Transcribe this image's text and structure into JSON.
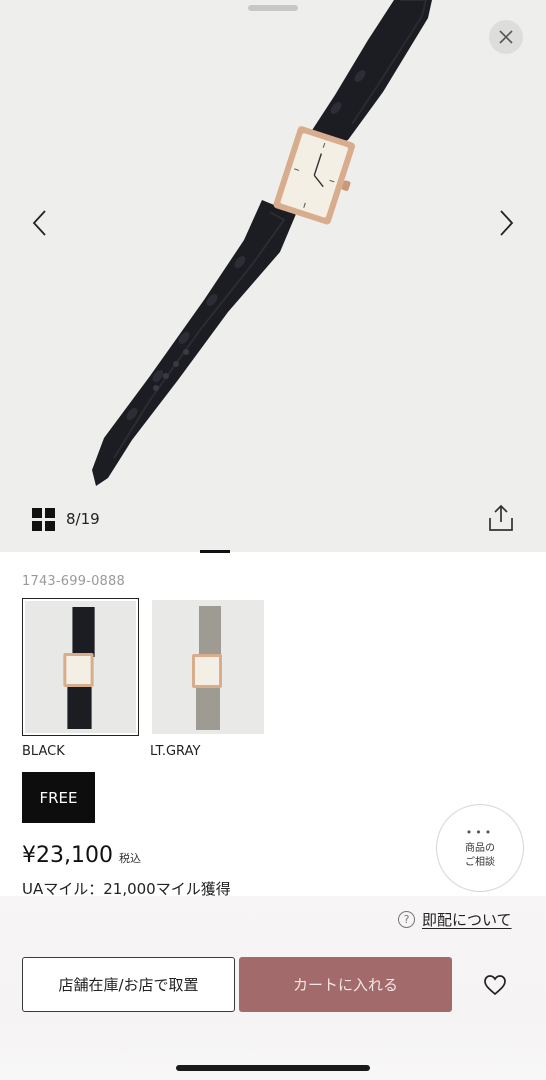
{
  "gallery": {
    "counter": "8/19"
  },
  "product": {
    "sku": "1743-699-0888",
    "colors": [
      {
        "label": "BLACK",
        "selected": true,
        "strap_color": "#1c1d22"
      },
      {
        "label": "LT.GRAY",
        "selected": false,
        "strap_color": "#9e9c92"
      }
    ],
    "size": "FREE",
    "price": "¥23,100",
    "tax_label": "税込",
    "mile": "UAマイル：21,000マイル獲得"
  },
  "consult": {
    "dots": "•••",
    "line1": "商品の",
    "line2": "ご相談"
  },
  "actions": {
    "sokuhai_link": "即配について",
    "store_button": "店舗在庫/お店で取置",
    "cart_button": "カートに入れる"
  },
  "colors": {
    "cart_button_bg": "#a36a6b",
    "hero_bg": "#eeeeec",
    "case_gold": "#d8ad8d"
  },
  "icons": [
    "close-icon",
    "chevron-left-icon",
    "chevron-right-icon",
    "grid-icon",
    "share-icon",
    "help-icon",
    "heart-icon"
  ]
}
